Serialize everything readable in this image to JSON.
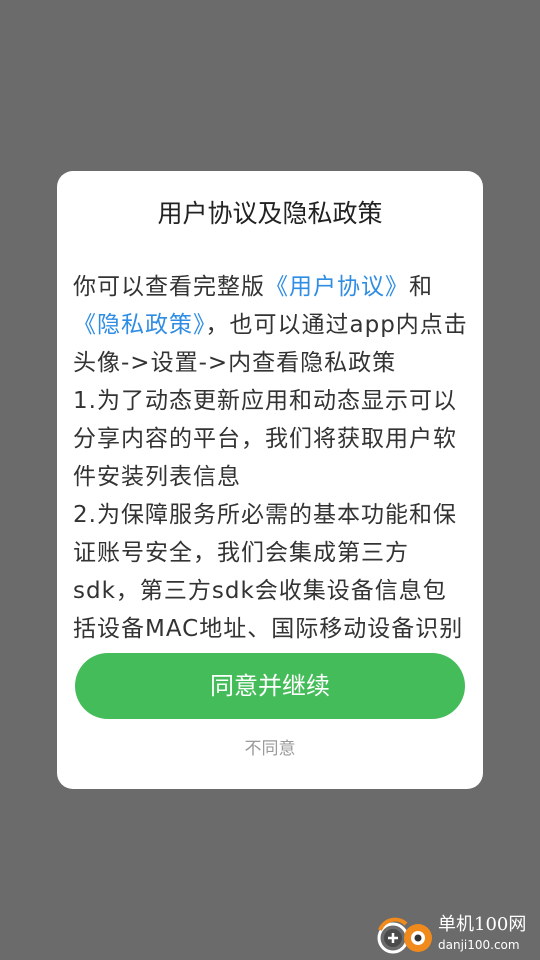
{
  "dialog": {
    "title": "用户协议及隐私政策",
    "content": {
      "intro_prefix": "你可以查看完整版",
      "user_agreement_link": "《用户协议》",
      "and_text": "和",
      "privacy_policy_link": "《隐私政策》",
      "intro_suffix": "，也可以通过app内点击头像->设置->内查看隐私政策",
      "item_1": "1.为了动态更新应用和动态显示可以分享内容的平台，我们将获取用户软件安装列表信息",
      "item_2": "2.为保障服务所必需的基本功能和保证账号安全，我们会集成第三方sdk，第三方sdk会收集设备信息包括设备MAC地址、国际移动设备识别码"
    },
    "agree_button_label": "同意并继续",
    "disagree_label": "不同意"
  },
  "watermark": {
    "name": "单机100网",
    "url": "danji100.com"
  },
  "colors": {
    "overlay": "#6b6b6b",
    "link": "#2f8de4",
    "primary_button": "#45bc5a"
  }
}
